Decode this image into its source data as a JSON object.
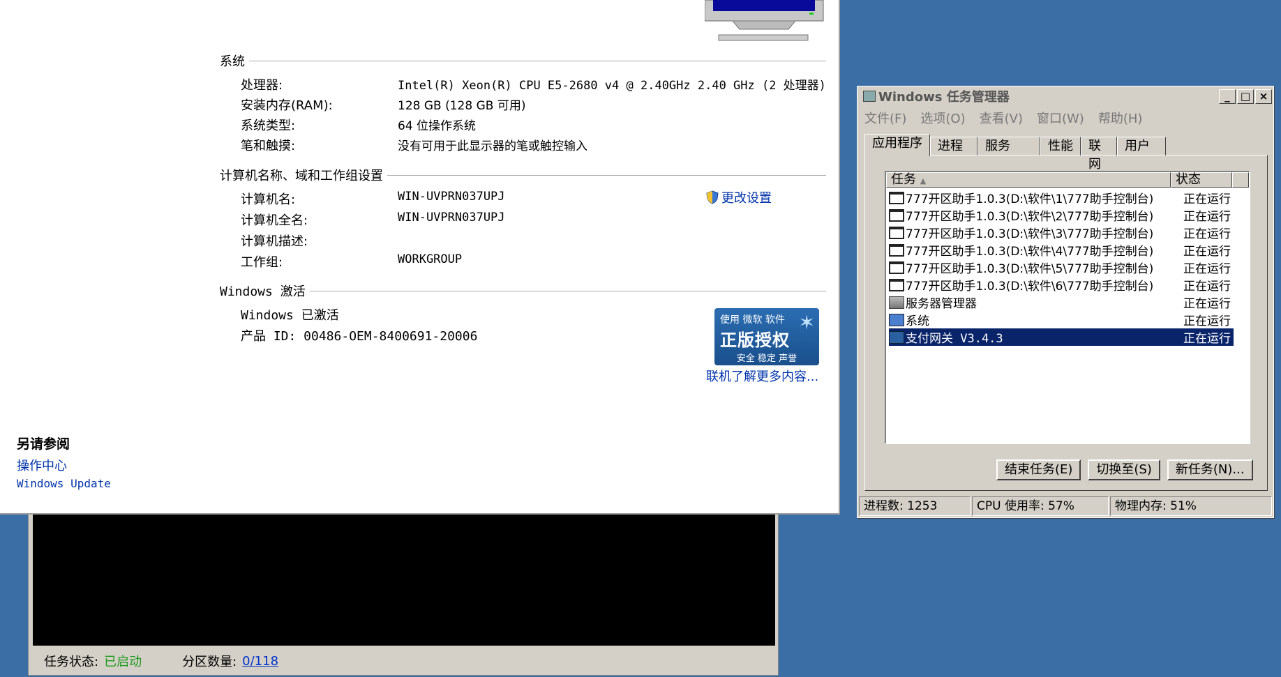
{
  "console": {
    "status_label": "任务状态:",
    "status_value": "已启动",
    "partition_label": "分区数量:",
    "partition_value": "0/118"
  },
  "system": {
    "section_system": "系统",
    "processor_label": "处理器:",
    "processor_value": "Intel(R) Xeon(R) CPU E5-2680 v4 @ 2.40GHz   2.40 GHz  (2 处理器)",
    "ram_label": "安装内存(RAM):",
    "ram_value": "128 GB (128 GB 可用)",
    "type_label": "系统类型:",
    "type_value": "64 位操作系统",
    "pen_label": "笔和触摸:",
    "pen_value": "没有可用于此显示器的笔或触控输入",
    "section_computer": "计算机名称、域和工作组设置",
    "name_label": "计算机名:",
    "name_value": "WIN-UVPRN037UPJ",
    "fullname_label": "计算机全名:",
    "fullname_value": "WIN-UVPRN037UPJ",
    "desc_label": "计算机描述:",
    "workgroup_label": "工作组:",
    "workgroup_value": "WORKGROUP",
    "change_settings": "更改设置",
    "section_activation": "Windows 激活",
    "activated": "Windows 已激活",
    "product_id": "产品 ID: 00486-OEM-8400691-20006",
    "badge_line1": "使用 微软 软件",
    "badge_line2": "正版授权",
    "badge_line3": "安全 稳定 声誉",
    "online_link": "联机了解更多内容...",
    "see_also": "另请参阅",
    "see_also_items": [
      "操作中心",
      "Windows Update"
    ]
  },
  "taskmgr": {
    "title": "Windows 任务管理器",
    "menu": [
      "文件(F)",
      "选项(O)",
      "查看(V)",
      "窗口(W)",
      "帮助(H)"
    ],
    "tabs": [
      "应用程序",
      "进程",
      "服务",
      "性能",
      "联网",
      "用户"
    ],
    "columns": {
      "task": "任务",
      "status": "状态"
    },
    "tasks": [
      {
        "name": "777开区助手1.0.3(D:\\软件\\1\\777助手控制台)",
        "status": "正在运行",
        "icon": "window-icon"
      },
      {
        "name": "777开区助手1.0.3(D:\\软件\\2\\777助手控制台)",
        "status": "正在运行",
        "icon": "window-icon"
      },
      {
        "name": "777开区助手1.0.3(D:\\软件\\3\\777助手控制台)",
        "status": "正在运行",
        "icon": "window-icon"
      },
      {
        "name": "777开区助手1.0.3(D:\\软件\\4\\777助手控制台)",
        "status": "正在运行",
        "icon": "window-icon"
      },
      {
        "name": "777开区助手1.0.3(D:\\软件\\5\\777助手控制台)",
        "status": "正在运行",
        "icon": "window-icon"
      },
      {
        "name": "777开区助手1.0.3(D:\\软件\\6\\777助手控制台)",
        "status": "正在运行",
        "icon": "window-icon"
      },
      {
        "name": "服务器管理器",
        "status": "正在运行",
        "icon": "server-manager-icon"
      },
      {
        "name": "系统",
        "status": "正在运行",
        "icon": "system-icon"
      },
      {
        "name": "支付网关 V3.4.3",
        "status": "正在运行",
        "icon": "gateway-icon",
        "selected": true
      }
    ],
    "buttons": {
      "end": "结束任务(E)",
      "switch": "切换至(S)",
      "new": "新任务(N)..."
    },
    "status": {
      "processes": "进程数: 1253",
      "cpu": "CPU 使用率: 57%",
      "memory": "物理内存: 51%"
    }
  }
}
